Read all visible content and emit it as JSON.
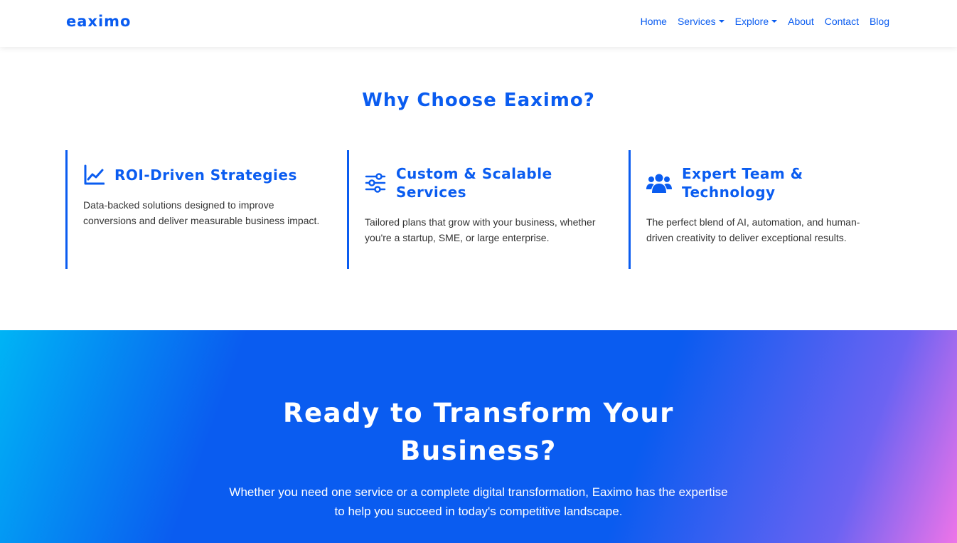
{
  "nav": {
    "brand": "eaximo",
    "links": [
      {
        "label": "Home"
      },
      {
        "label": "Services"
      },
      {
        "label": "Explore"
      },
      {
        "label": "About"
      },
      {
        "label": "Contact"
      },
      {
        "label": "Blog"
      }
    ]
  },
  "why": {
    "title": "Why Choose Eaximo?",
    "features": [
      {
        "icon": "line-chart-icon",
        "title": "ROI-Driven Strategies",
        "desc": "Data-backed solutions designed to improve conversions and deliver measurable business impact."
      },
      {
        "icon": "sliders-icon",
        "title": "Custom & Scalable Services",
        "desc": "Tailored plans that grow with your business, whether you're a startup, SME, or large enterprise."
      },
      {
        "icon": "users-icon",
        "title": "Expert Team & Technology",
        "desc": "The perfect blend of AI, automation, and human-driven creativity to deliver exceptional results."
      }
    ]
  },
  "cta": {
    "title": "Ready to Transform Your Business?",
    "text": "Whether you need one service or a complete digital transformation, Eaximo has the expertise to help you succeed in today's competitive landscape."
  },
  "colors": {
    "brand": "#0a5cf0",
    "text": "#333333",
    "gradient_start": "#00b4f5",
    "gradient_end": "#ee74e8"
  }
}
